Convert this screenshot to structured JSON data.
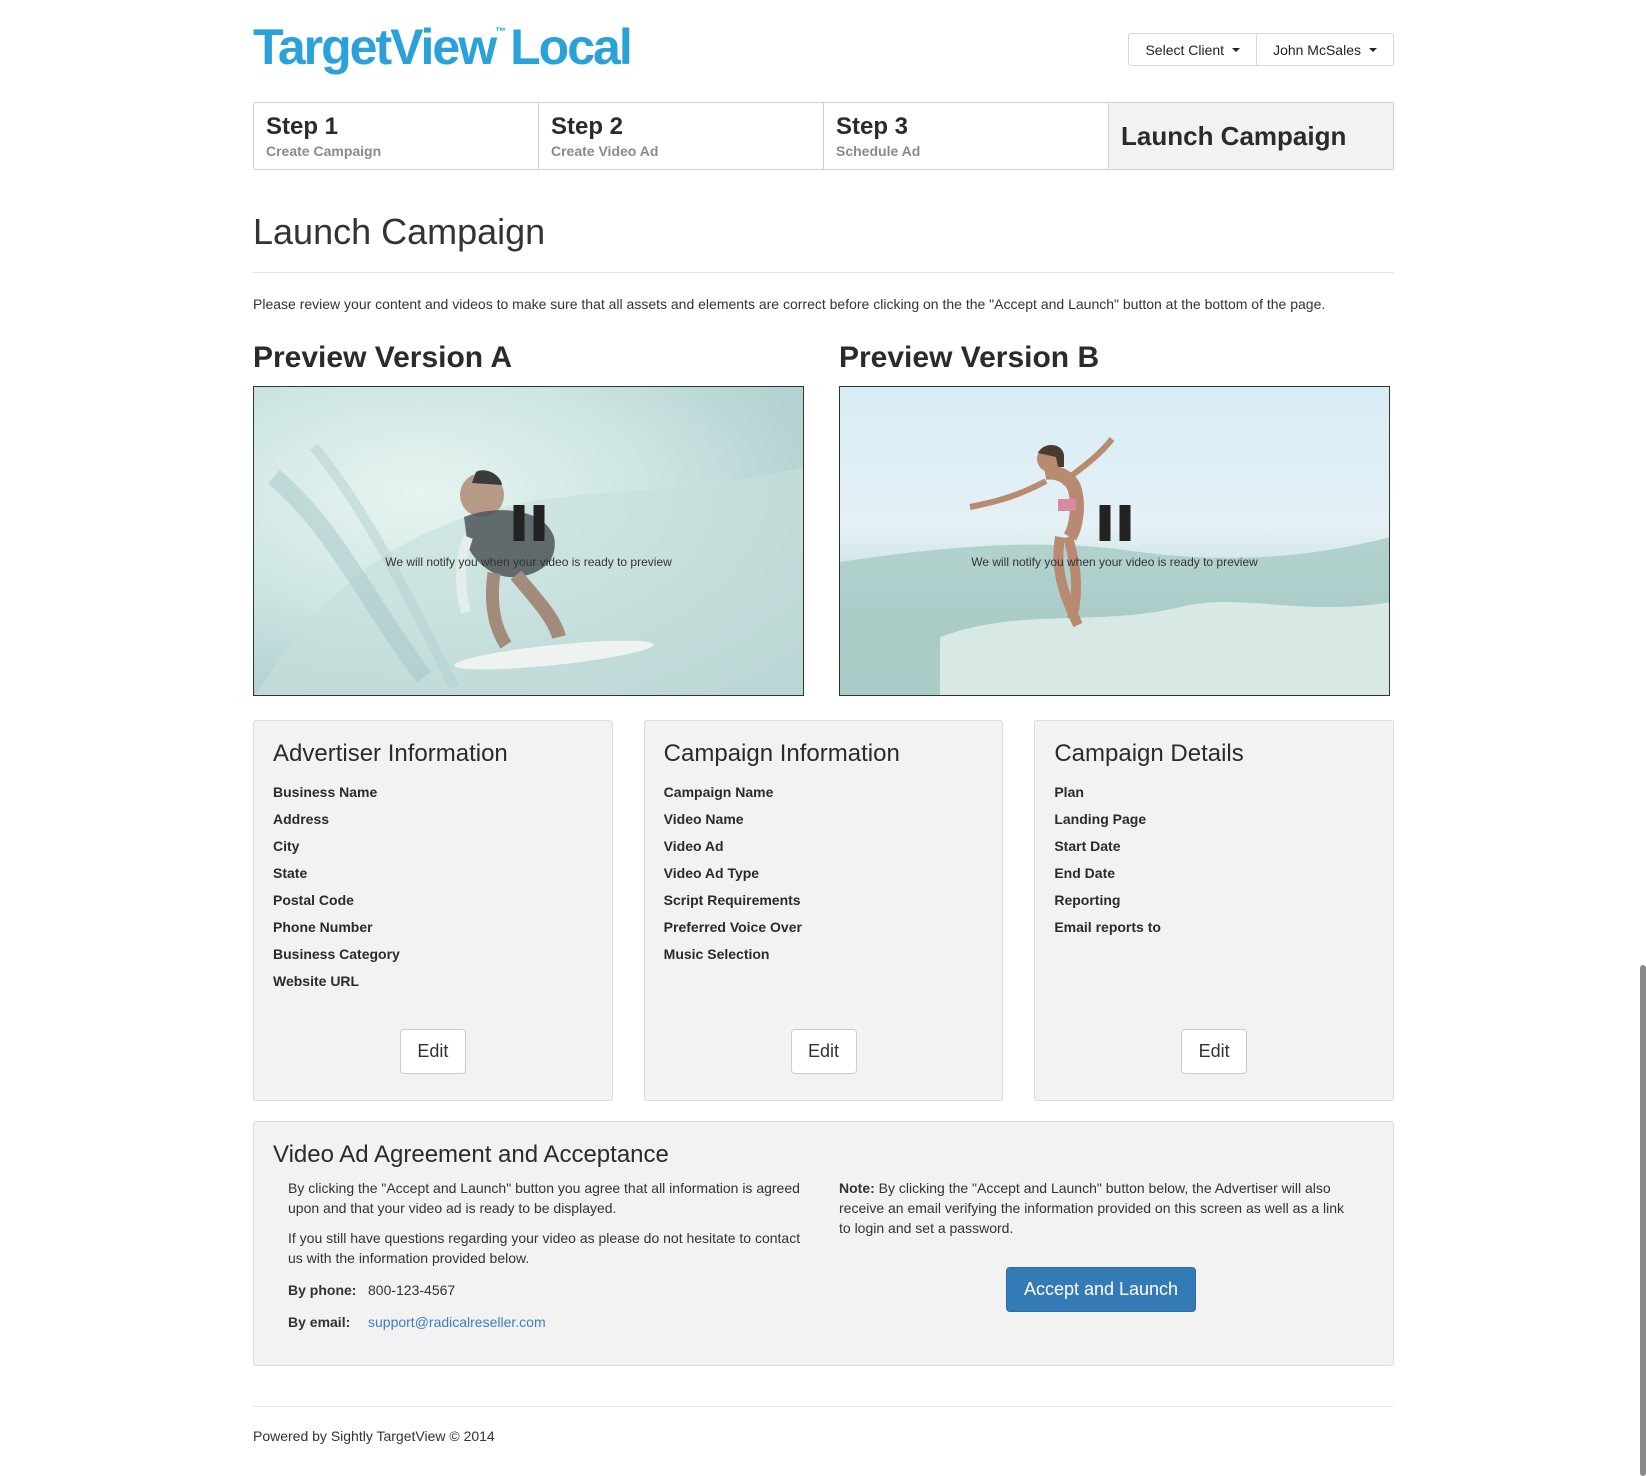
{
  "header": {
    "logo_text": "TargetView",
    "logo_tm": "™",
    "logo_suffix": "Local",
    "select_client_label": "Select Client",
    "user_label": "John McSales"
  },
  "steps": [
    {
      "title": "Step 1",
      "subtitle": "Create Campaign"
    },
    {
      "title": "Step 2",
      "subtitle": "Create Video Ad"
    },
    {
      "title": "Step 3",
      "subtitle": "Schedule Ad"
    },
    {
      "title": "Launch Campaign"
    }
  ],
  "page": {
    "title": "Launch Campaign",
    "intro": "Please review your content and videos to make sure that all assets and elements are correct before clicking on the the \"Accept and Launch\" button at the bottom of the page."
  },
  "previews": {
    "a": {
      "title": "Preview Version A",
      "notice": "We will notify you when your video is ready to preview"
    },
    "b": {
      "title": "Preview Version B",
      "notice": "We will notify you when your video is ready to preview"
    }
  },
  "panels": {
    "advertiser": {
      "title": "Advertiser Information",
      "fields": [
        "Business Name",
        "Address",
        "City",
        "State",
        "Postal Code",
        "Phone Number",
        "Business Category",
        "Website URL"
      ],
      "edit_label": "Edit"
    },
    "campaign_info": {
      "title": "Campaign Information",
      "fields": [
        "Campaign Name",
        "Video Name",
        "Video Ad",
        "Video Ad Type",
        "Script Requirements",
        "Preferred Voice Over",
        "Music Selection"
      ],
      "edit_label": "Edit"
    },
    "campaign_details": {
      "title": "Campaign Details",
      "fields": [
        "Plan",
        "Landing Page",
        "Start Date",
        "End Date",
        "Reporting",
        "Email reports to"
      ],
      "edit_label": "Edit"
    }
  },
  "agreement": {
    "title": "Video Ad Agreement and Acceptance",
    "para1": "By clicking the \"Accept and Launch\" button you agree that all information is agreed upon and that your video ad is ready to be displayed.",
    "para2": "If you still have questions regarding your video as please do not hesitate to contact us with the information provided below.",
    "phone_label": "By phone:",
    "phone": "800-123-4567",
    "email_label": "By email:",
    "email": "support@radicalreseller.com",
    "note_label": "Note:",
    "note": "By clicking the \"Accept and Launch\" button below, the Advertiser will also receive an email verifying the information provided on this screen as well as a link to login and set a password.",
    "accept_label": "Accept and Launch"
  },
  "footer": {
    "text": "Powered by Sightly TargetView © 2014"
  },
  "colors": {
    "brand": "#2aa2d9",
    "primary_button": "#337ab7",
    "link": "#3a7fc1",
    "panel_bg": "#f1f2f1"
  }
}
